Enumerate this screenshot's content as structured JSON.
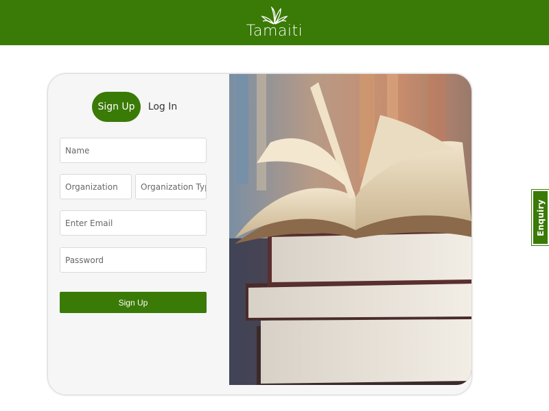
{
  "header": {
    "brand": "Tamaiti",
    "logo_icon": "leaf-sprout-icon",
    "background": "#3a7a06"
  },
  "auth": {
    "tabs": [
      {
        "label": "Sign Up",
        "active": true
      },
      {
        "label": "Log In",
        "active": false
      }
    ],
    "fields": {
      "name": {
        "placeholder": "Name",
        "value": ""
      },
      "organization": {
        "placeholder": "Organization",
        "value": ""
      },
      "organization_type": {
        "placeholder": "Organization Type",
        "value": ""
      },
      "email": {
        "placeholder": "Enter Email",
        "value": ""
      },
      "password": {
        "placeholder": "Password",
        "value": ""
      }
    },
    "submit_label": "Sign Up"
  },
  "hero_image": "stack-of-books-photo",
  "enquiry_tab": {
    "label": "Enquiry"
  },
  "colors": {
    "accent": "#3a7a06"
  }
}
